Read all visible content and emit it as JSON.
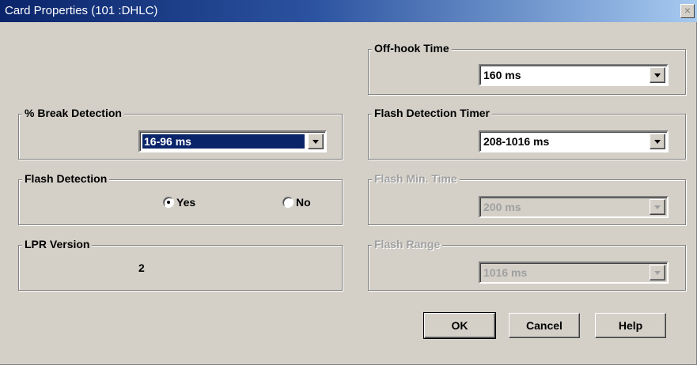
{
  "window": {
    "title": "Card Properties (101 :DHLC)",
    "close_glyph": "×"
  },
  "groups": {
    "break_detection": {
      "label": "% Break Detection",
      "value": "16-96 ms"
    },
    "flash_detection": {
      "label": "Flash Detection",
      "yes_label": "Yes",
      "no_label": "No",
      "selected": "Yes"
    },
    "lpr_version": {
      "label": "LPR Version",
      "value": "2"
    },
    "off_hook_time": {
      "label": "Off-hook Time",
      "value": "160 ms"
    },
    "flash_detection_timer": {
      "label": "Flash Detection Timer",
      "value": "208-1016 ms"
    },
    "flash_min_time": {
      "label": "Flash Min. Time",
      "value": "200 ms"
    },
    "flash_range": {
      "label": "Flash Range",
      "value": "1016 ms"
    }
  },
  "buttons": {
    "ok": "OK",
    "cancel": "Cancel",
    "help": "Help"
  }
}
